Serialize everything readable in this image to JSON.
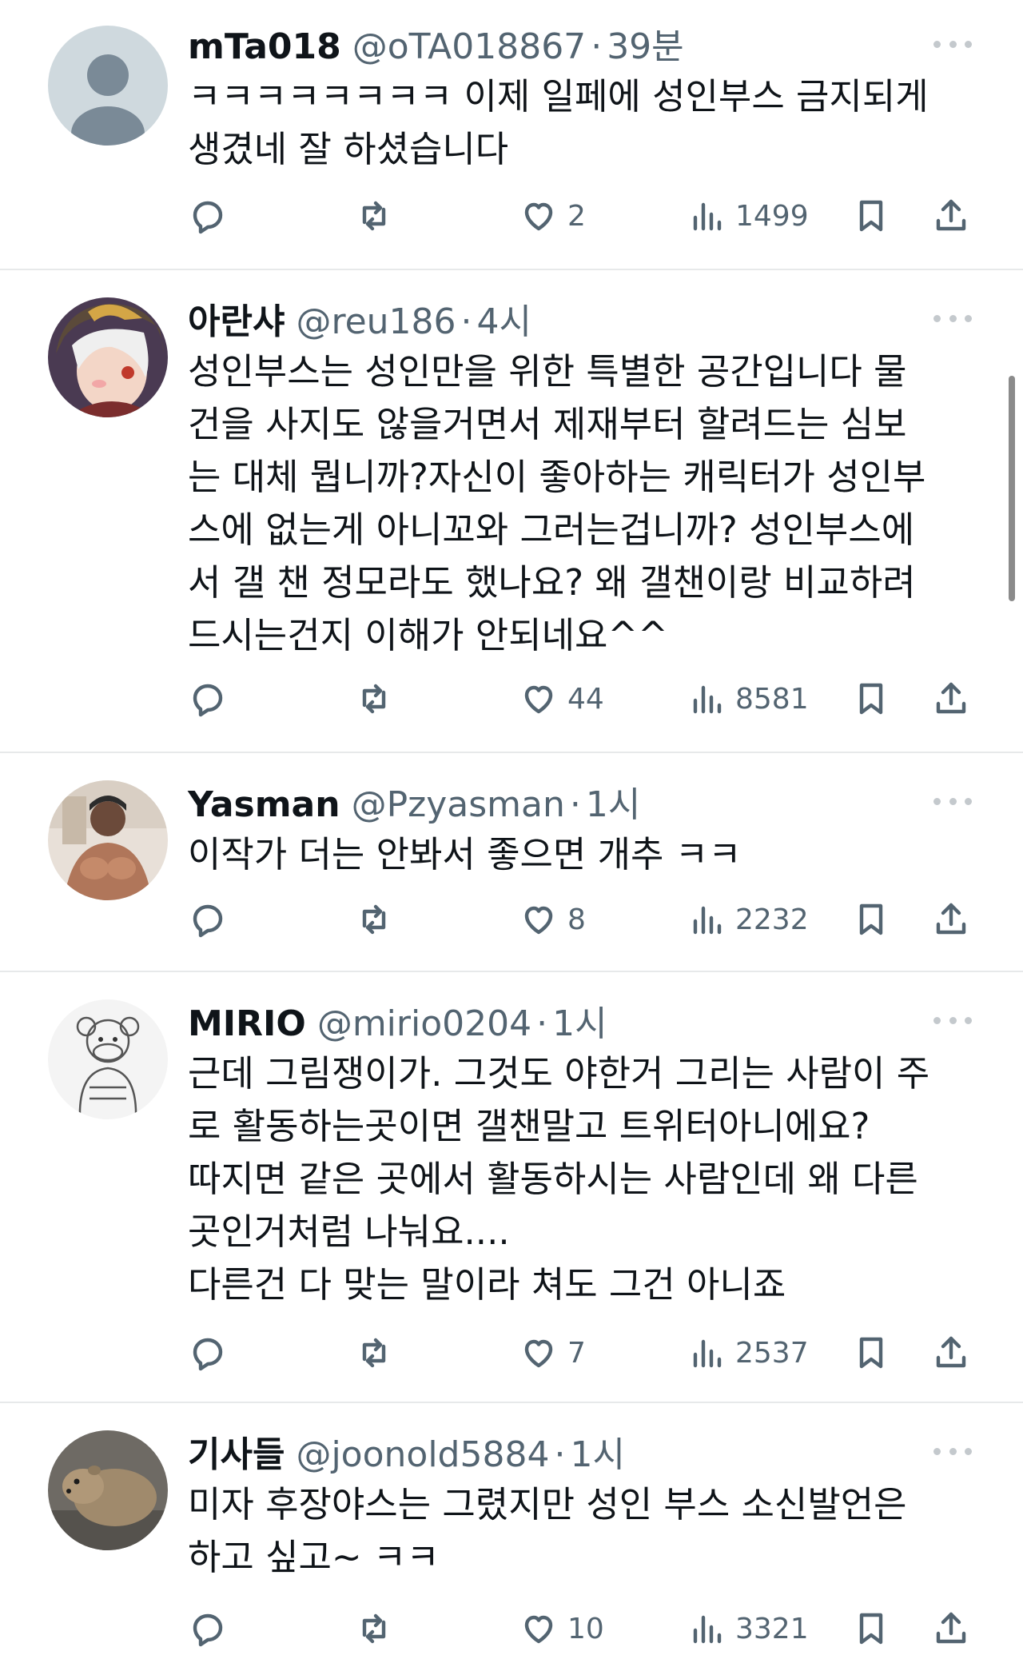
{
  "tweets": [
    {
      "display_name": "mTa018",
      "handle": "@oTA018867",
      "time": "39분",
      "text": "ㅋㅋㅋㅋㅋㅋㅋㅋ 이제 일페에 성인부스 금지되게\n생겼네 잘 하셨습니다",
      "reply_count": "",
      "retweet_count": "",
      "like_count": "2",
      "view_count": "1499"
    },
    {
      "display_name": "아란샤",
      "handle": "@reu186",
      "time": "4시",
      "text": "성인부스는 성인만을 위한 특별한 공간입니다 물\n건을 사지도 않을거면서 제재부터 할려드는 심보\n는 대체 뭡니까?자신이 좋아하는 캐릭터가 성인부\n스에 없는게 아니꼬와 그러는겁니까? 성인부스에\n서 갤 챈 정모라도 했나요? 왜 갤챈이랑 비교하려\n드시는건지 이해가 안되네요^^",
      "reply_count": "",
      "retweet_count": "",
      "like_count": "44",
      "view_count": "8581"
    },
    {
      "display_name": "Yasman",
      "handle": "@Pzyasman",
      "time": "1시",
      "text": "이작가 더는 안봐서 좋으면 개추 ㅋㅋ",
      "reply_count": "",
      "retweet_count": "",
      "like_count": "8",
      "view_count": "2232"
    },
    {
      "display_name": "MIRIO",
      "handle": "@mirio0204",
      "time": "1시",
      "text": "근데 그림쟁이가. 그것도 야한거 그리는 사람이 주\n로 활동하는곳이면 갤챈말고 트위터아니에요?\n따지면 같은 곳에서 활동하시는 사람인데 왜 다른\n곳인거처럼 나눠요....\n다른건 다 맞는 말이라 쳐도 그건 아니죠",
      "reply_count": "",
      "retweet_count": "",
      "like_count": "7",
      "view_count": "2537"
    },
    {
      "display_name": "기사들",
      "handle": "@joonold5884",
      "time": "1시",
      "text": "미자 후장야스는 그렸지만 성인 부스 소신발언은\n하고 싶고~ ㅋㅋ",
      "reply_count": "",
      "retweet_count": "",
      "like_count": "10",
      "view_count": "3321"
    }
  ],
  "icons": {
    "reply": "reply-icon",
    "retweet": "retweet-icon",
    "like": "heart-icon",
    "views": "views-icon",
    "bookmark": "bookmark-icon",
    "share": "share-icon",
    "more": "more-icon"
  },
  "colors": {
    "text_primary": "#0f1419",
    "text_secondary": "#536471",
    "divider": "#e7e9ea",
    "background": "#ffffff"
  }
}
